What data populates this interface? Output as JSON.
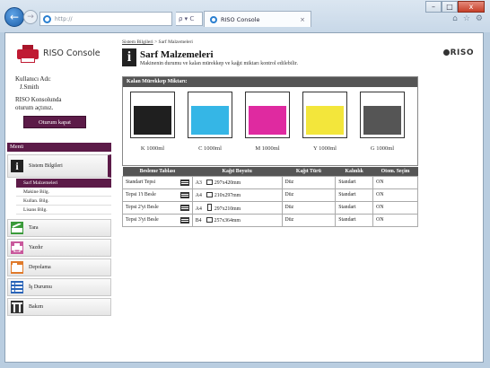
{
  "browser": {
    "url": "http://",
    "tab_title": "RISO Console",
    "tab_close": "×",
    "addr_tools": "ρ ▾ ᑕ",
    "back_icon": "←",
    "forward_icon": "→",
    "win_controls": [
      "–",
      "□",
      "x"
    ],
    "right_icons": [
      "⌂",
      "☆",
      "⚙"
    ]
  },
  "sidebar": {
    "logo_text": "RISO Console",
    "user_label": "Kullanıcı Adı:",
    "user_name": "J.Smith",
    "console_line1": "RISO Konsolunda",
    "console_line2": "oturum açtınız.",
    "logout_label": "Oturum kapat",
    "menu_header": "Menü",
    "items": [
      {
        "label": "Sistem Bilgileri",
        "icon": "i"
      },
      {
        "label": "Tara",
        "icon": "scan-icon"
      },
      {
        "label": "Yazdır",
        "icon": "print-icon"
      },
      {
        "label": "Depolama",
        "icon": "storage-icon"
      },
      {
        "label": "İş Durumu",
        "icon": "job-status-icon"
      },
      {
        "label": "Bakım",
        "icon": "maintenance-icon"
      }
    ],
    "subitems": [
      "Sarf Malzemeleri",
      "Makine Bilg.",
      "Kullan. Bilg.",
      "Lisans Bilg."
    ]
  },
  "main": {
    "breadcrumb_link": "Sistem Bilgileri",
    "breadcrumb_rest": " > Sarf Malzemeleri",
    "title_icon": "i",
    "title": "Sarf Malzemeleri",
    "description": "Makinenin durumu ve kalan mürekkep ve kağıt miktarı kontrol edilebilir.",
    "brand": "RISO",
    "ink_header": "Kalan Mürekkep Miktarı:",
    "inks": [
      {
        "label": "K 1000ml",
        "color": "#1f1f1f",
        "level": 0.7
      },
      {
        "label": "C 1000ml",
        "color": "#35b6e6",
        "level": 0.7
      },
      {
        "label": "M 1000ml",
        "color": "#df2aa0",
        "level": 0.7
      },
      {
        "label": "Y 1000ml",
        "color": "#f3e63b",
        "level": 0.7
      },
      {
        "label": "G  1000ml",
        "color": "#555555",
        "level": 0.7
      }
    ],
    "feed_headers": [
      "Besleme Tablası",
      "Kağıt Boyutu",
      "Kağıt Türü",
      "Kalınlık",
      "Otom. Seçim"
    ],
    "feed_rows": [
      {
        "tray": "Standart Tepsi",
        "size": "A3",
        "dims": "297x420mm",
        "type": "Düz",
        "thickness": "Standart",
        "auto": "ON",
        "orient": "landscape"
      },
      {
        "tray": "Tepsi 1'i Besle",
        "size": "A4",
        "dims": "210x297mm",
        "type": "Düz",
        "thickness": "Standart",
        "auto": "ON",
        "orient": "landscape"
      },
      {
        "tray": "Tepsi 2'yi Besle",
        "size": "A4",
        "dims": "297x210mm",
        "type": "Düz",
        "thickness": "Standart",
        "auto": "ON",
        "orient": "portrait"
      },
      {
        "tray": "Tepsi 3'yi Besle",
        "size": "B4",
        "dims": "257x364mm",
        "type": "Düz",
        "thickness": "Standart",
        "auto": "ON",
        "orient": "landscape"
      }
    ]
  }
}
